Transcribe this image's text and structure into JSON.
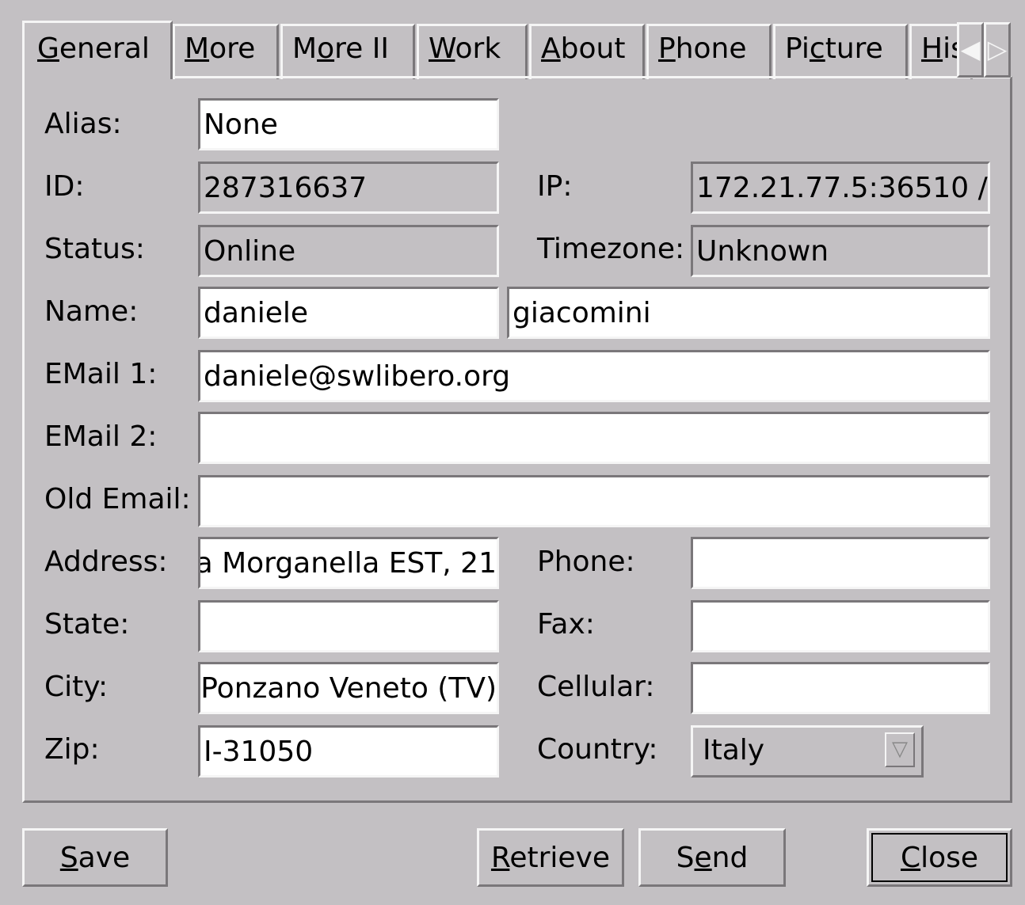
{
  "tabs": [
    {
      "pre": "",
      "key": "G",
      "post": "eneral"
    },
    {
      "pre": "",
      "key": "M",
      "post": "ore"
    },
    {
      "pre": "M",
      "key": "o",
      "post": "re II"
    },
    {
      "pre": "",
      "key": "W",
      "post": "ork"
    },
    {
      "pre": "",
      "key": "A",
      "post": "bout"
    },
    {
      "pre": "",
      "key": "P",
      "post": "hone"
    },
    {
      "pre": "Pi",
      "key": "c",
      "post": "ture"
    },
    {
      "pre": "",
      "key": "H",
      "post": "is"
    }
  ],
  "tab_scroll": {
    "left": "◀",
    "right": "▷"
  },
  "labels": {
    "alias": "Alias:",
    "id": "ID:",
    "ip": "IP:",
    "status": "Status:",
    "timezone": "Timezone:",
    "name": "Name:",
    "email1": "EMail 1:",
    "email2": "EMail 2:",
    "old_email": "Old Email:",
    "address": "Address:",
    "phone": "Phone:",
    "state": "State:",
    "fax": "Fax:",
    "city": "City:",
    "cellular": "Cellular:",
    "zip": "Zip:",
    "country": "Country:"
  },
  "values": {
    "alias": "None",
    "id": "287316637",
    "ip": "/ 172.21.77.5:36510",
    "status": "Online",
    "timezone": "Unknown",
    "first_name": "daniele",
    "last_name": "giacomini",
    "email1": "daniele@swlibero.org",
    "email2": "",
    "old_email": "",
    "address": "a Morganella EST, 21",
    "phone": "",
    "state": "",
    "fax": "",
    "city": "Ponzano Veneto (TV)",
    "cellular": "",
    "zip": "I-31050",
    "country": "Italy"
  },
  "buttons": {
    "save": {
      "pre": "",
      "key": "S",
      "post": "ave"
    },
    "retrieve": {
      "pre": "",
      "key": "R",
      "post": "etrieve"
    },
    "send": {
      "pre": "S",
      "key": "e",
      "post": "nd"
    },
    "close": {
      "pre": "",
      "key": "C",
      "post": "lose"
    }
  }
}
